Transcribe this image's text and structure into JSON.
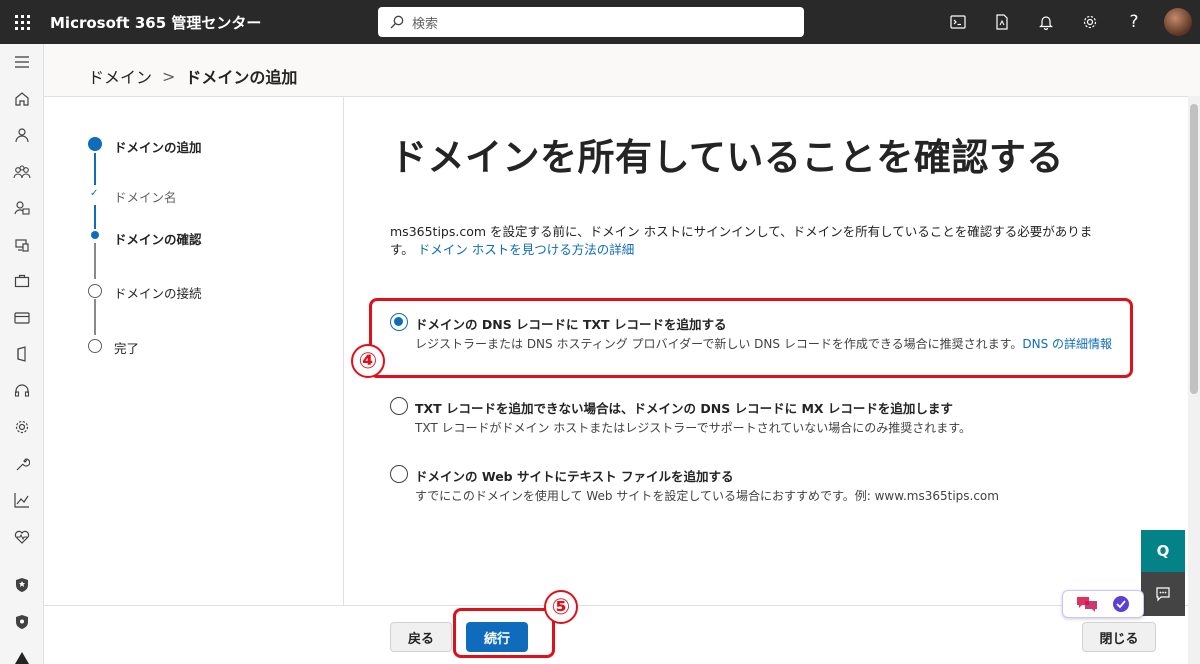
{
  "topbar": {
    "app_title": "Microsoft 365 管理センター",
    "search_placeholder": "検索"
  },
  "breadcrumb": {
    "parent": "ドメイン",
    "separator": ">",
    "current": "ドメインの追加"
  },
  "steps": [
    {
      "label": "ドメインの追加",
      "state": "current-major"
    },
    {
      "label": "ドメイン名",
      "state": "done"
    },
    {
      "label": "ドメインの確認",
      "state": "current"
    },
    {
      "label": "ドメインの接続",
      "state": "pending"
    },
    {
      "label": "完了",
      "state": "pending"
    }
  ],
  "main": {
    "heading": "ドメインを所有していることを確認する",
    "intro_text": "ms365tips.com を設定する前に、ドメイン ホストにサインインして、ドメインを所有していることを確認する必要がありま す。",
    "intro_link": "ドメイン ホストを見つける方法の詳細",
    "options": [
      {
        "title": "ドメインの DNS レコードに TXT レコードを追加する",
        "desc": "レジストラーまたは DNS ホスティング プロバイダーで新しい DNS レコードを作成できる場合に推奨されます。",
        "link": "DNS の詳細情報",
        "checked": true
      },
      {
        "title": "TXT レコードを追加できない場合は、ドメインの DNS レコードに MX レコードを追加します",
        "desc": "TXT レコードがドメイン ホストまたはレジストラーでサポートされていない場合にのみ推奨されます。",
        "link": "",
        "checked": false
      },
      {
        "title": "ドメインの Web サイトにテキスト ファイルを追加する",
        "desc": "すでにこのドメインを使用して Web サイトを設定している場合におすすめです。例: www.ms365tips.com",
        "link": "",
        "checked": false
      }
    ]
  },
  "annotations": {
    "num4": "④",
    "num5": "⑤",
    "color": "#e0101a"
  },
  "footer": {
    "back_label": "戻る",
    "next_label": "続行",
    "close_label": "閉じる"
  },
  "widgets": {
    "help_label": "Q"
  },
  "colors": {
    "accent": "#0f6cbd",
    "topbar": "#292929",
    "help_fab": "#038387"
  }
}
